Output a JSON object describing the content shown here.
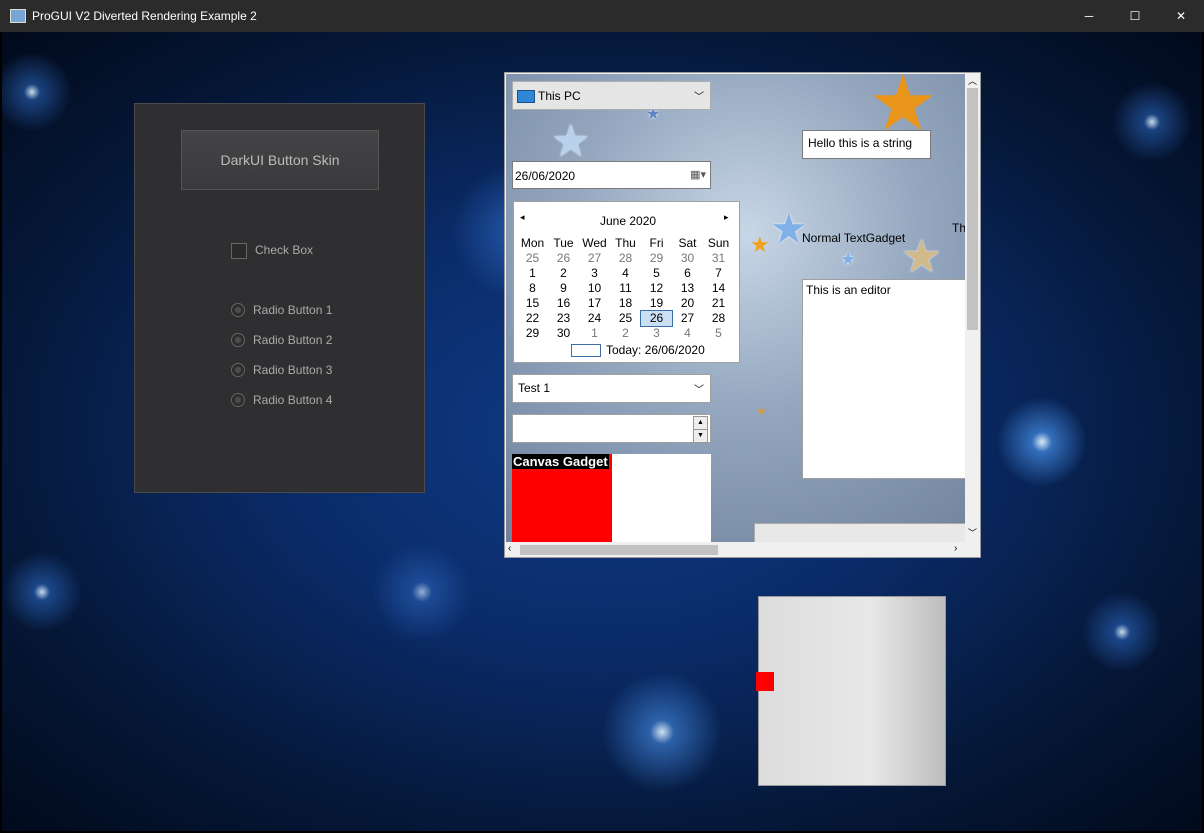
{
  "window": {
    "title": "ProGUI V2 Diverted Rendering Example 2",
    "minimize": "─",
    "maximize": "☐",
    "close": "✕"
  },
  "dark_panel": {
    "button_label": "DarkUI Button Skin",
    "checkbox_label": "Check Box",
    "radios": [
      "Radio Button 1",
      "Radio Button 2",
      "Radio Button 3",
      "Radio Button 4"
    ]
  },
  "explorer": {
    "location_combo": "This PC",
    "string_field": "Hello this is a string",
    "date_field": "26/06/2020",
    "text_gadget": "Normal TextGadget",
    "text_gadget_clipped": "Th",
    "editor_text": "This is an editor",
    "combo2": "Test 1",
    "spin_value": "",
    "canvas_label": "Canvas Gadget"
  },
  "calendar": {
    "month_year": "June 2020",
    "days": [
      "Mon",
      "Tue",
      "Wed",
      "Thu",
      "Fri",
      "Sat",
      "Sun"
    ],
    "weeks": [
      [
        "25",
        "26",
        "27",
        "28",
        "29",
        "30",
        "31"
      ],
      [
        "1",
        "2",
        "3",
        "4",
        "5",
        "6",
        "7"
      ],
      [
        "8",
        "9",
        "10",
        "11",
        "12",
        "13",
        "14"
      ],
      [
        "15",
        "16",
        "17",
        "18",
        "19",
        "20",
        "21"
      ],
      [
        "22",
        "23",
        "24",
        "25",
        "26",
        "27",
        "28"
      ],
      [
        "29",
        "30",
        "1",
        "2",
        "3",
        "4",
        "5"
      ]
    ],
    "selected": "26",
    "today_label": "Today: 26/06/2020"
  },
  "colors": {
    "canvas_fill": "#ff0000",
    "panel_bg": "#2f2f31",
    "accent": "#3a6ea5"
  }
}
